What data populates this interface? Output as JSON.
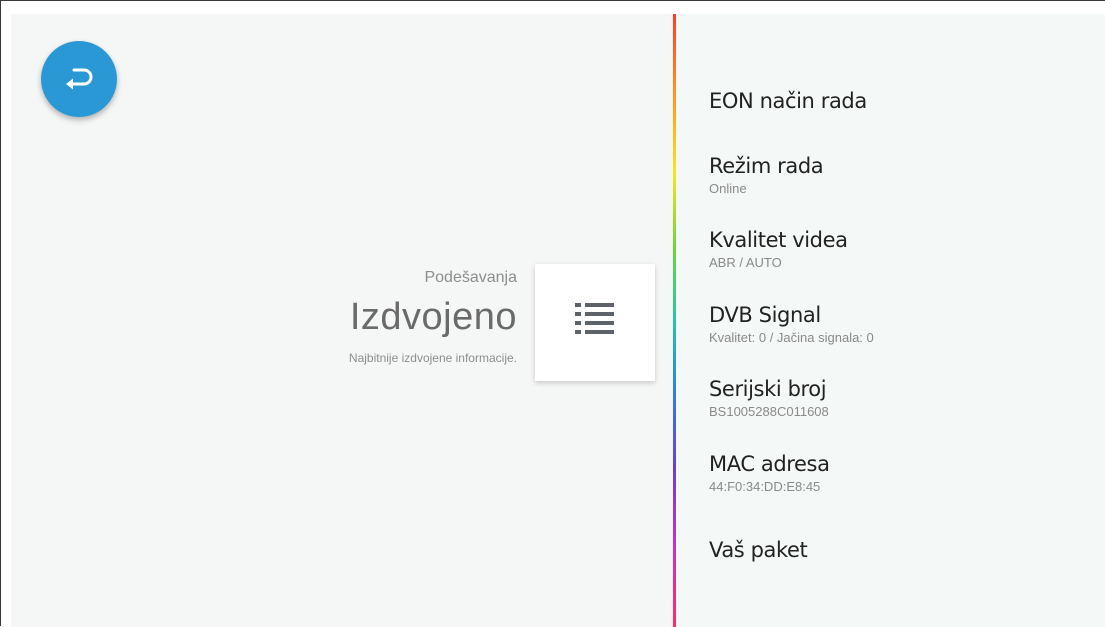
{
  "section": {
    "subtitle": "Podešavanja",
    "title": "Izdvojeno",
    "description": "Najbitnije izdvojene informacije."
  },
  "back_button": {
    "icon": "return-arrow-icon",
    "color": "#2b98d6"
  },
  "list_card": {
    "icon": "list-icon"
  },
  "menu": {
    "items": [
      {
        "label": "EON način rada",
        "value": ""
      },
      {
        "label": "Režim rada",
        "value": "Online"
      },
      {
        "label": "Kvalitet videa",
        "value": "ABR / AUTO"
      },
      {
        "label": "DVB Signal",
        "value": "Kvalitet: 0 / Jačina signala: 0"
      },
      {
        "label": "Serijski broj",
        "value": "BS1005288C011608"
      },
      {
        "label": "MAC adresa",
        "value": "44:F0:34:DD:E8:45"
      },
      {
        "label": "Vaš paket",
        "value": ""
      }
    ]
  }
}
